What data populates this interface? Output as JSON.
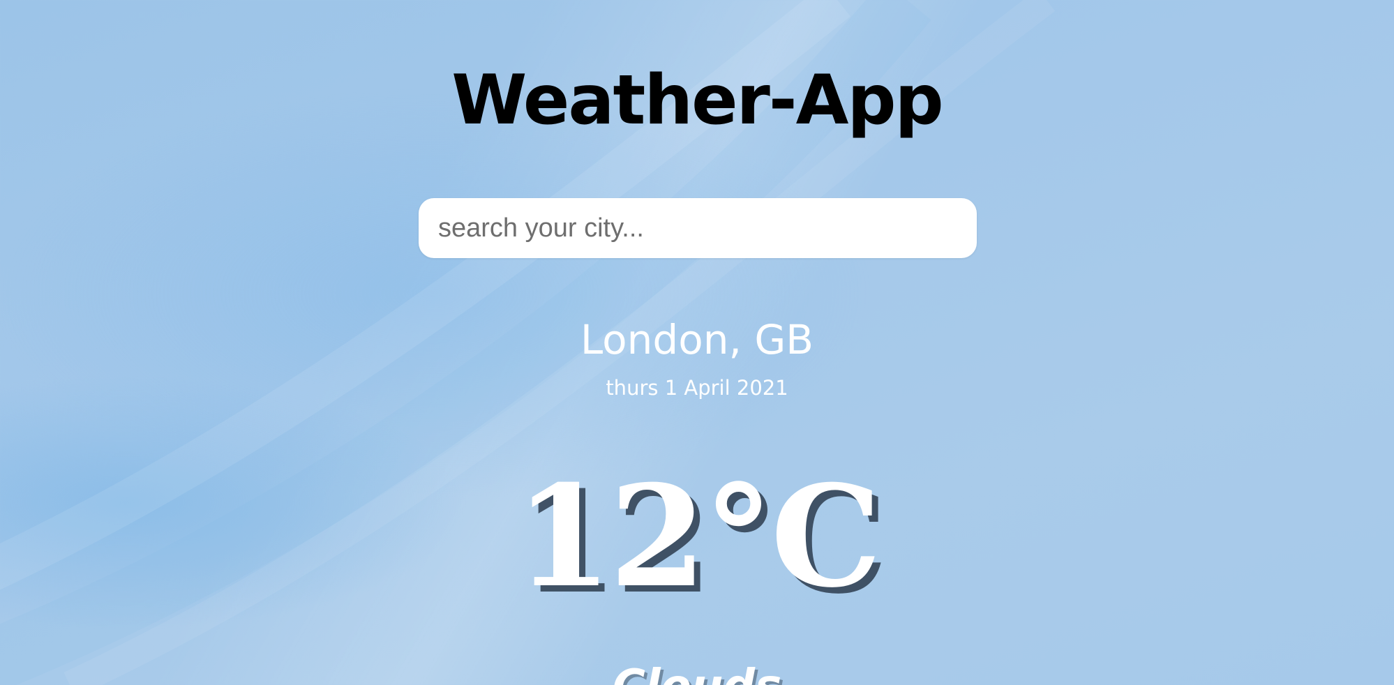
{
  "app": {
    "title": "Weather-App"
  },
  "search": {
    "placeholder": "search your city...",
    "value": ""
  },
  "location": {
    "city": "London, GB",
    "date": "thurs 1 April 2021"
  },
  "current": {
    "temperature": "12°C",
    "condition": "Clouds"
  },
  "colors": {
    "background": "#a4c8ea",
    "text": "#ffffff",
    "title": "#000000",
    "temperature_shadow": "#2d3c4e"
  }
}
